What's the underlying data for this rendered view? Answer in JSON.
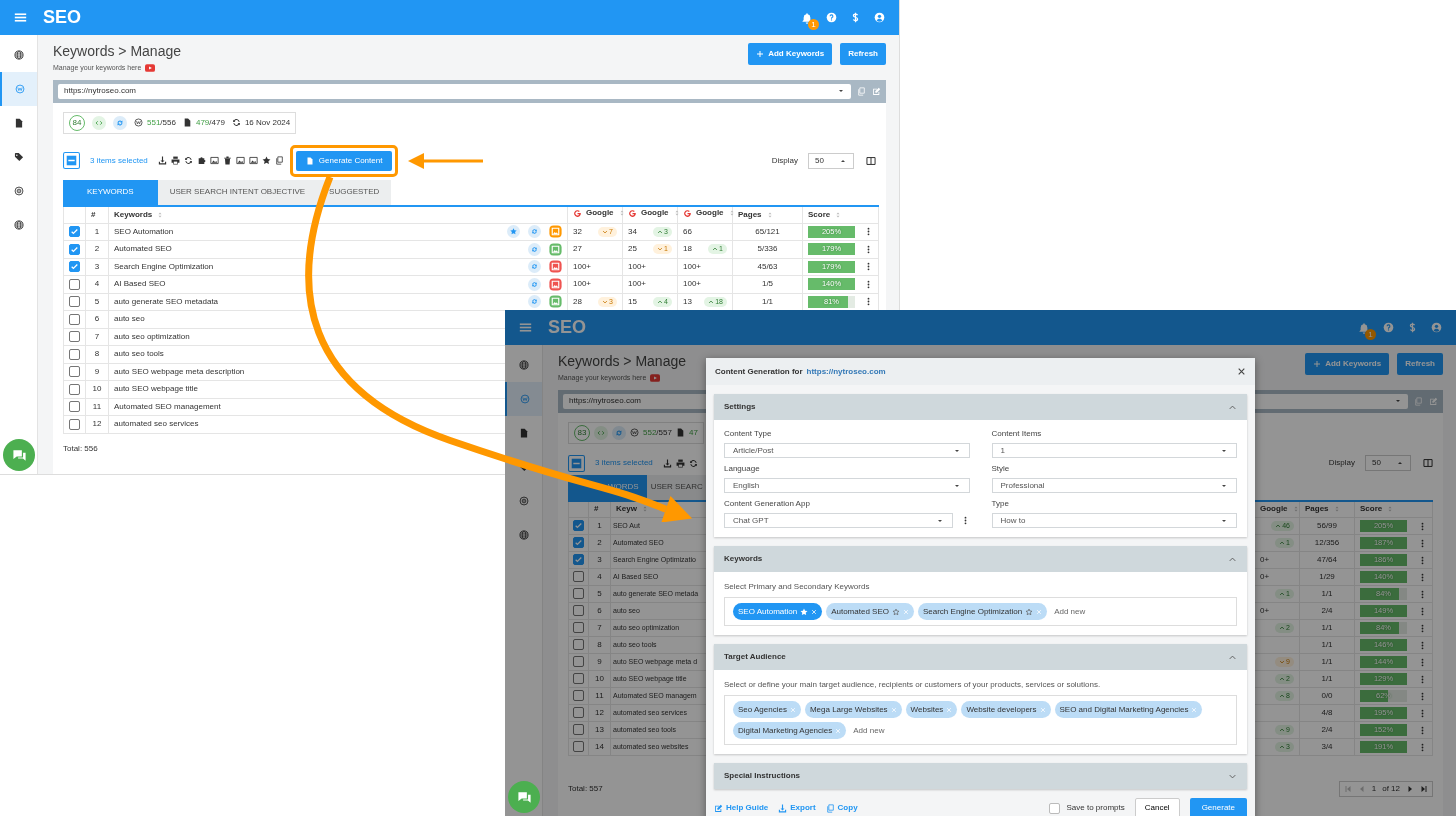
{
  "screen_1": {
    "app": {
      "title": "SEO",
      "notifications": "1"
    },
    "sidebar": [
      {
        "selected": false
      },
      {
        "selected": true
      },
      {
        "selected": false
      },
      {
        "selected": false
      },
      {
        "selected": false
      },
      {
        "selected": false
      }
    ],
    "page": {
      "title": "Keywords > Manage",
      "subtitle": "Manage your keywords here",
      "buttons": [
        "Add Keywords",
        "Refresh"
      ]
    },
    "url_select": {
      "value": "https://nytroseo.com"
    },
    "stats": {
      "score": "84",
      "indexed": "551",
      "indexed_total": "/556",
      "pages": "479",
      "pages_total": "/479",
      "date": "16 Nov 2024"
    },
    "toolbar": {
      "indeterminate": true,
      "selection": "3 items selected",
      "action": "Generate Content",
      "display_label": "Display",
      "display_value": "50"
    },
    "tabs": [
      {
        "label": "KEYWORDS",
        "selected": true
      },
      {
        "label": "USER SEARCH INTENT OBJECTIVE",
        "selected": false
      },
      {
        "label": "SUGGESTED",
        "selected": false
      }
    ],
    "table": {
      "columns": [
        "#",
        "Keywords",
        "Google",
        "Google",
        "Google",
        "Pages",
        "Score"
      ],
      "rows": [
        {
          "checked": true,
          "num": "1",
          "keyword": "SEO Automation",
          "starred": true,
          "color": "#ff9800",
          "ranks": [
            {
              "value": "32",
              "change": {
                "value": "7",
                "rising": false
              }
            },
            {
              "value": "34",
              "change": {
                "value": "3",
                "rising": true
              }
            },
            {
              "value": "66"
            }
          ],
          "pages": "65/121",
          "score": "205%",
          "level": 1
        },
        {
          "checked": true,
          "num": "2",
          "keyword": "Automated SEO",
          "starred": false,
          "color": "#66bb6a",
          "ranks": [
            {
              "value": "27"
            },
            {
              "value": "25",
              "change": {
                "value": "1",
                "rising": false
              }
            },
            {
              "value": "18",
              "change": {
                "value": "1",
                "rising": true
              }
            }
          ],
          "pages": "5/336",
          "score": "179%",
          "level": 1
        },
        {
          "checked": true,
          "num": "3",
          "keyword": "Search Engine Optimization",
          "starred": false,
          "color": "#ef5350",
          "ranks": [
            {
              "value": "100+"
            },
            {
              "value": "100+"
            },
            {
              "value": "100+"
            }
          ],
          "pages": "45/63",
          "score": "179%",
          "level": 1
        },
        {
          "checked": false,
          "num": "4",
          "keyword": "AI Based SEO",
          "starred": false,
          "color": "#ef5350",
          "ranks": [
            {
              "value": "100+"
            },
            {
              "value": "100+"
            },
            {
              "value": "100+"
            }
          ],
          "pages": "1/5",
          "score": "140%",
          "level": 1
        },
        {
          "checked": false,
          "num": "5",
          "keyword": "auto generate SEO metadata",
          "starred": false,
          "color": "#66bb6a",
          "ranks": [
            {
              "value": "28",
              "change": {
                "value": "3",
                "rising": false
              }
            },
            {
              "value": "15",
              "change": {
                "value": "4",
                "rising": true
              }
            },
            {
              "value": "13",
              "change": {
                "value": "18",
                "rising": true
              }
            }
          ],
          "pages": "1/1",
          "score": "81%",
          "level": 0.86
        },
        {
          "checked": false,
          "num": "6",
          "keyword": "auto seo"
        },
        {
          "checked": false,
          "num": "7",
          "keyword": "auto seo optimization"
        },
        {
          "checked": false,
          "num": "8",
          "keyword": "auto seo tools"
        },
        {
          "checked": false,
          "num": "9",
          "keyword": "auto SEO webpage meta description"
        },
        {
          "checked": false,
          "num": "10",
          "keyword": "auto SEO webpage title"
        },
        {
          "checked": false,
          "num": "11",
          "keyword": "Automated SEO management"
        },
        {
          "checked": false,
          "num": "12",
          "keyword": "automated seo services"
        }
      ]
    },
    "total": "Total: 556"
  },
  "screen_2": {
    "app": {
      "title": "SEO",
      "notifications": "1"
    },
    "sidebar": [
      {
        "selected": false
      },
      {
        "selected": true
      },
      {
        "selected": false
      },
      {
        "selected": false
      },
      {
        "selected": false
      },
      {
        "selected": false
      }
    ],
    "page": {
      "title": "Keywords > Manage",
      "subtitle": "Manage your keywords here",
      "buttons": [
        "Add Keywords",
        "Refresh"
      ]
    },
    "url_select": {
      "value": "https://nytroseo.com"
    },
    "stats": {
      "score": "83",
      "indexed": "552",
      "indexed_total": "/557",
      "pages": "47"
    },
    "toolbar": {
      "indeterminate": true,
      "selection": "3 items selected",
      "display_label": "Display",
      "display_value": "50"
    },
    "tabs": [
      {
        "label": "WORDS",
        "selected": true
      },
      {
        "label": "USER SEARC",
        "selected": false
      }
    ],
    "table": {
      "columns_left": [
        "#",
        "Keyw"
      ],
      "columns_right": [
        "Google",
        "Pages",
        "Score"
      ],
      "rows": [
        {
          "checked": true,
          "num": "1",
          "keyword": "SEO Aut",
          "change": {
            "value": "46",
            "rising": true
          },
          "pages": "56/99",
          "score": "205%",
          "level": 1
        },
        {
          "checked": true,
          "num": "2",
          "keyword": "Automated SEO",
          "change": {
            "value": "1",
            "rising": true
          },
          "pages": "12/356",
          "score": "187%",
          "level": 1
        },
        {
          "checked": true,
          "num": "3",
          "keyword": "Search Engine Optimizatio",
          "rank": "0+",
          "pages": "47/64",
          "score": "186%",
          "level": 1
        },
        {
          "checked": false,
          "num": "4",
          "keyword": "AI Based SEO",
          "rank": "0+",
          "pages": "1/29",
          "score": "140%",
          "level": 1
        },
        {
          "checked": false,
          "num": "5",
          "keyword": "auto generate SEO metada",
          "change": {
            "value": "1",
            "rising": true
          },
          "pages": "1/1",
          "score": "84%",
          "level": 0.83
        },
        {
          "checked": false,
          "num": "6",
          "keyword": "auto seo",
          "rank": "0+",
          "pages": "2/4",
          "score": "149%",
          "level": 1
        },
        {
          "checked": false,
          "num": "7",
          "keyword": "auto seo optimization",
          "change": {
            "value": "2",
            "rising": true
          },
          "pages": "1/1",
          "score": "84%",
          "level": 0.83
        },
        {
          "checked": false,
          "num": "8",
          "keyword": "auto seo tools",
          "pages": "1/1",
          "score": "146%",
          "level": 1
        },
        {
          "checked": false,
          "num": "9",
          "keyword": "auto SEO webpage meta d",
          "change": {
            "value": "9",
            "rising": false
          },
          "pages": "1/1",
          "score": "144%",
          "level": 1
        },
        {
          "checked": false,
          "num": "10",
          "keyword": "auto SEO webpage title",
          "change": {
            "value": "2",
            "rising": true
          },
          "pages": "1/1",
          "score": "129%",
          "level": 1
        },
        {
          "checked": false,
          "num": "11",
          "keyword": "Automated SEO managem",
          "change": {
            "value": "8",
            "rising": true
          },
          "pages": "0/0",
          "score": "62%",
          "level": 0.6
        },
        {
          "checked": false,
          "num": "12",
          "keyword": "automated seo services",
          "pages": "4/8",
          "score": "195%",
          "level": 1
        },
        {
          "checked": false,
          "num": "13",
          "keyword": "automated seo tools",
          "change": {
            "value": "9",
            "rising": true
          },
          "pages": "2/4",
          "score": "152%",
          "level": 1
        },
        {
          "checked": false,
          "num": "14",
          "keyword": "automated seo websites",
          "change": {
            "value": "3",
            "rising": true
          },
          "pages": "3/4",
          "score": "191%",
          "level": 1
        }
      ]
    },
    "pagination": {
      "page": "1",
      "of": "of 12"
    },
    "total": "Total: 557"
  },
  "modal": {
    "title": "Content Generation for",
    "site": "https://nytroseo.com",
    "sections": [
      {
        "kind": "fields",
        "title": "Settings",
        "expanded": true,
        "fields": [
          {
            "label": "Content Type",
            "value": "Article/Post"
          },
          {
            "label": "Content Items",
            "value": "1"
          },
          {
            "label": "Language",
            "value": "English"
          },
          {
            "label": "Style",
            "value": "Professional"
          },
          {
            "label": "Content Generation App",
            "value": "Chat GPT",
            "menu": true
          },
          {
            "label": "Type",
            "value": "How to"
          }
        ]
      },
      {
        "kind": "chips",
        "title": "Keywords",
        "expanded": true,
        "hint": "Select Primary and Secondary Keywords",
        "chips": [
          {
            "label": "SEO Automation",
            "primary": true
          },
          {
            "label": "Automated SEO",
            "primary": false
          },
          {
            "label": "Search Engine Optimization",
            "primary": false
          }
        ],
        "placeholder": "Add new"
      },
      {
        "kind": "chips",
        "title": "Target Audience",
        "expanded": true,
        "hint": "Select or define your main target audience, recipients or customers of your products, services or solutions.",
        "chips": [
          {
            "label": "Seo Agencies"
          },
          {
            "label": "Mega Large Websites"
          },
          {
            "label": "Websites"
          },
          {
            "label": "Website developers"
          },
          {
            "label": "SEO and Digital Marketing Agencies"
          },
          {
            "label": "Digital Marketing Agencies"
          }
        ],
        "placeholder": "Add new"
      },
      {
        "title": "Special Instructions",
        "expanded": false
      }
    ],
    "footer": {
      "links": [
        "Help Guide",
        "Export",
        "Copy"
      ],
      "save": {
        "label": "Save to prompts",
        "checked": false
      },
      "buttons": [
        "Cancel",
        "Generate"
      ]
    }
  }
}
